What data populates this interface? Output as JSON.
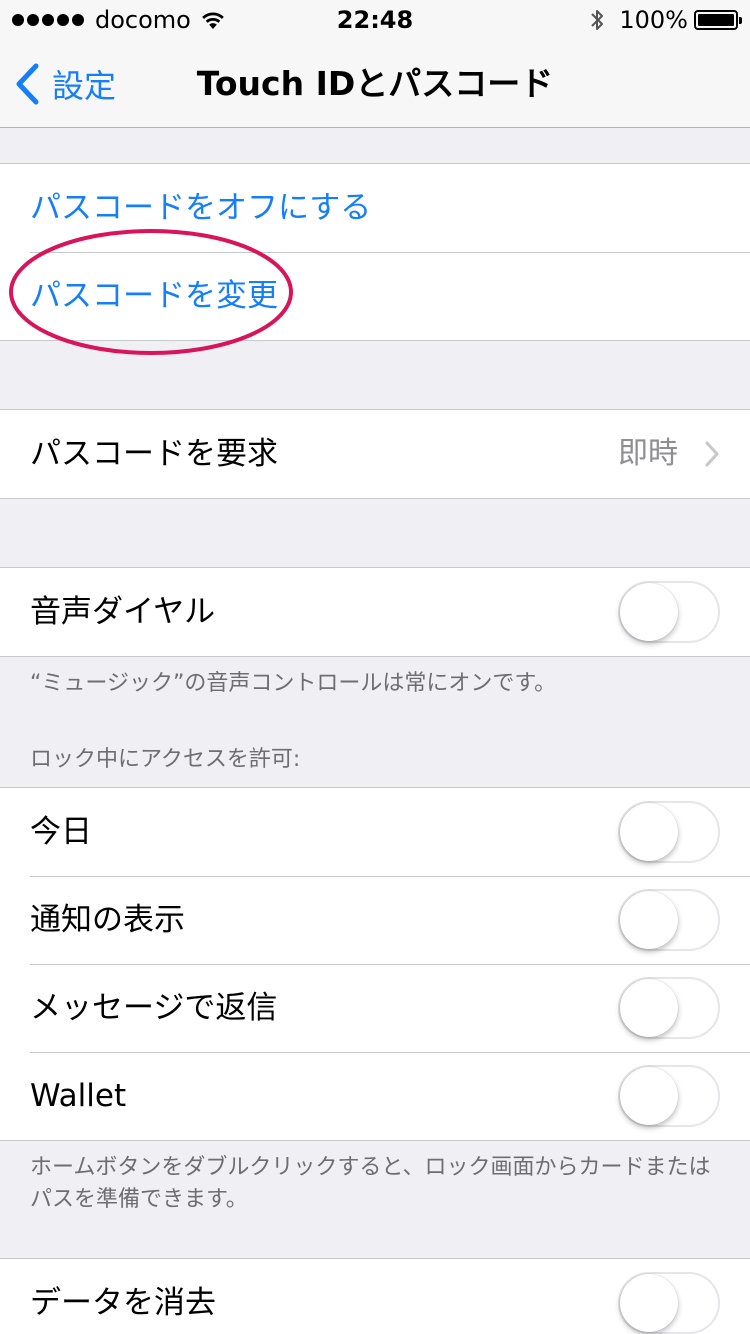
{
  "status_bar": {
    "carrier": "docomo",
    "time": "22:48",
    "battery_text": "100%",
    "battery_level": 1.0
  },
  "nav": {
    "back_label": "設定",
    "title": "Touch IDとパスコード"
  },
  "passcode_group": {
    "turn_off": "パスコードをオフにする",
    "change": "パスコードを変更"
  },
  "require": {
    "label": "パスコードを要求",
    "value": "即時"
  },
  "voice_dial": {
    "label": "音声ダイヤル",
    "enabled": false,
    "footer": "“ミュージック”の音声コントロールは常にオンです。"
  },
  "lock_access": {
    "header": "ロック中にアクセスを許可:",
    "items": [
      {
        "label": "今日",
        "enabled": false
      },
      {
        "label": "通知の表示",
        "enabled": false
      },
      {
        "label": "メッセージで返信",
        "enabled": false
      },
      {
        "label": "Wallet",
        "enabled": false
      }
    ],
    "footer": "ホームボタンをダブルクリックすると、ロック画面からカードまたはパスを準備できます。"
  },
  "erase": {
    "label": "データを消去",
    "enabled": false
  },
  "colors": {
    "accent": "#147efb",
    "annotation": "#d9145a"
  }
}
